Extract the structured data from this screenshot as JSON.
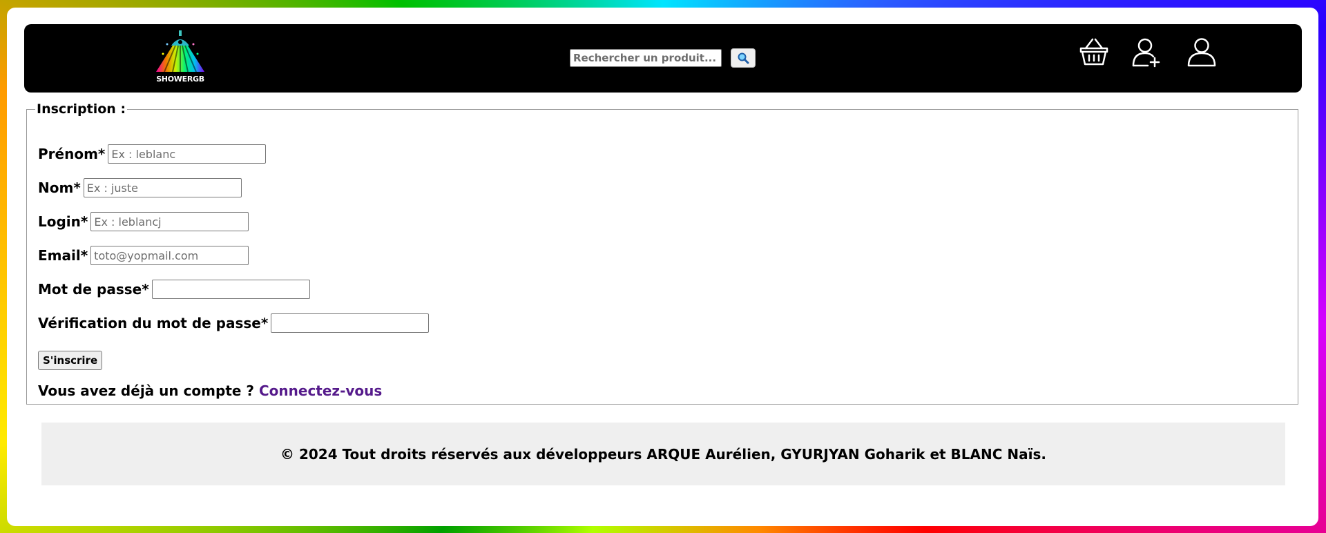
{
  "header": {
    "logo_text": "SHOWERGB",
    "search": {
      "placeholder": "Rechercher un produit..."
    },
    "icons": [
      "search-icon",
      "basket-icon",
      "user-add-icon",
      "user-icon"
    ]
  },
  "form": {
    "legend": "Inscription :",
    "fields": [
      {
        "label": "Prénom*",
        "placeholder": "Ex : leblanc",
        "value": ""
      },
      {
        "label": "Nom*",
        "placeholder": "Ex : juste",
        "value": ""
      },
      {
        "label": "Login*",
        "placeholder": "Ex : leblancj",
        "value": ""
      },
      {
        "label": "Email*",
        "placeholder": "toto@yopmail.com",
        "value": ""
      },
      {
        "label": "Mot de passe*",
        "placeholder": "",
        "value": ""
      },
      {
        "label": "Vérification du mot de passe*",
        "placeholder": "",
        "value": ""
      }
    ],
    "submit_label": "S'inscrire",
    "login_prompt": "Vous avez déjà un compte ?",
    "login_link": "Connectez-vous"
  },
  "footer": {
    "text": "© 2024 Tout droits réservés aux développeurs ARQUE Aurélien, GYURJYAN Goharik et BLANC Naïs."
  },
  "colors": {
    "header_bg": "#000000",
    "link": "#551a8b",
    "footer_bg": "#efefef"
  }
}
